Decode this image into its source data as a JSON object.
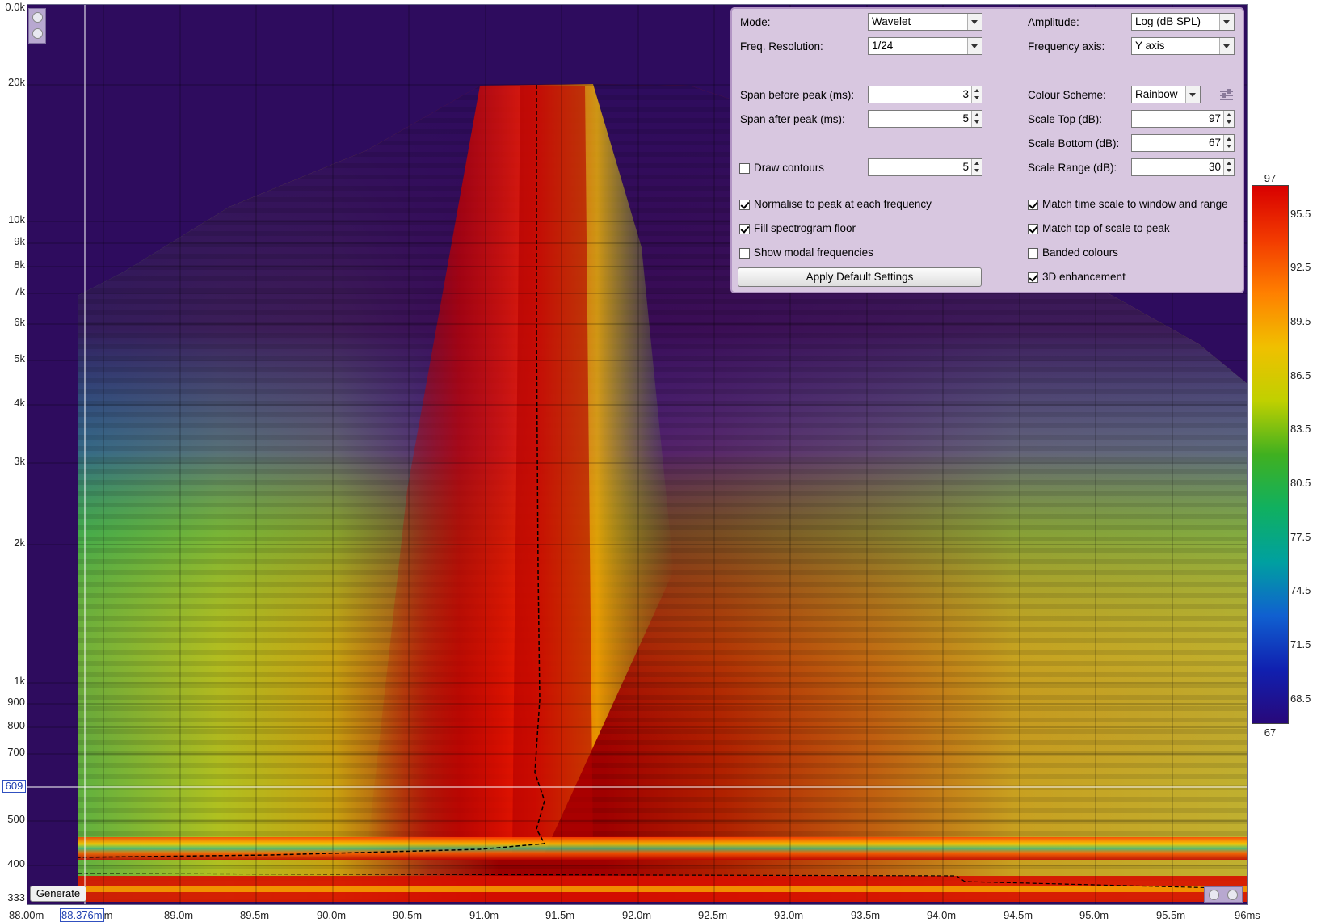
{
  "y_axis": {
    "ticks": [
      "0.0k",
      "20k",
      "10k",
      "9k",
      "8k",
      "7k",
      "6k",
      "5k",
      "4k",
      "3k",
      "2k",
      "1k",
      "900",
      "800",
      "700",
      "609",
      "500",
      "400",
      "333"
    ]
  },
  "x_axis": {
    "ticks": [
      "88.00m",
      "89.0m",
      "89.5m",
      "90.0m",
      "90.5m",
      "91.0m",
      "91.5m",
      "92.0m",
      "92.5m",
      "93.0m",
      "93.5m",
      "94.0m",
      "94.5m",
      "95.0m",
      "95.5m",
      "96ms"
    ],
    "cursor_value": "88.376m",
    "cursor_suffix": "m"
  },
  "cursor_readout_y": "609",
  "generate_label": "Generate",
  "panel": {
    "mode_label": "Mode:",
    "mode_value": "Wavelet",
    "freq_res_label": "Freq. Resolution:",
    "freq_res_value": "1/24",
    "span_before_label": "Span before peak (ms):",
    "span_before_value": "3",
    "span_after_label": "Span after peak (ms):",
    "span_after_value": "5",
    "draw_contours_label": "Draw contours",
    "draw_contours_checked": false,
    "contour_value": "5",
    "normalise_label": "Normalise to peak at each frequency",
    "normalise_checked": true,
    "fill_floor_label": "Fill spectrogram floor",
    "fill_floor_checked": true,
    "show_modal_label": "Show modal frequencies",
    "show_modal_checked": false,
    "apply_label": "Apply Default Settings",
    "amplitude_label": "Amplitude:",
    "amplitude_value": "Log (dB SPL)",
    "freq_axis_label": "Frequency axis:",
    "freq_axis_value": "Y axis",
    "colour_scheme_label": "Colour Scheme:",
    "colour_scheme_value": "Rainbow",
    "scale_top_label": "Scale Top (dB):",
    "scale_top_value": "97",
    "scale_bottom_label": "Scale Bottom (dB):",
    "scale_bottom_value": "67",
    "scale_range_label": "Scale Range (dB):",
    "scale_range_value": "30",
    "match_time_label": "Match time scale to window and range",
    "match_time_checked": true,
    "match_top_label": "Match top of scale to peak",
    "match_top_checked": true,
    "banded_label": "Banded colours",
    "banded_checked": false,
    "enhance_label": "3D enhancement",
    "enhance_checked": true
  },
  "colorbar": {
    "top": "97",
    "bottom": "67",
    "labels": [
      "95.5",
      "92.5",
      "89.5",
      "86.5",
      "83.5",
      "80.5",
      "77.5",
      "74.5",
      "71.5",
      "68.5"
    ]
  },
  "colors": {
    "background": "#2e0c5e",
    "panel": "#d8c7e0",
    "peak": "#c00000"
  }
}
